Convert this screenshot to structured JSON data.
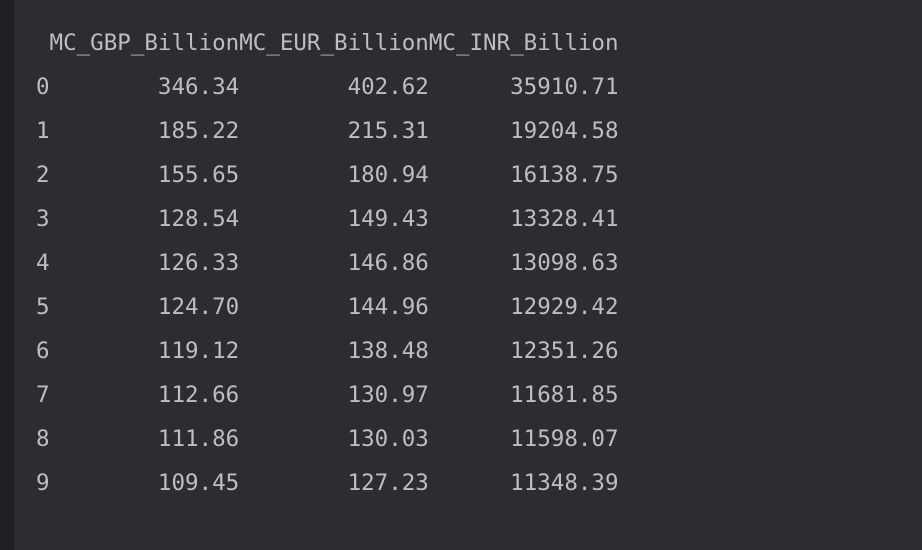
{
  "dataframe": {
    "index_header": "",
    "columns": [
      "MC_GBP_Billion",
      "MC_EUR_Billion",
      "MC_INR_Billion"
    ],
    "rows": [
      {
        "index": "0",
        "gbp": "346.34",
        "eur": "402.62",
        "inr": "35910.71"
      },
      {
        "index": "1",
        "gbp": "185.22",
        "eur": "215.31",
        "inr": "19204.58"
      },
      {
        "index": "2",
        "gbp": "155.65",
        "eur": "180.94",
        "inr": "16138.75"
      },
      {
        "index": "3",
        "gbp": "128.54",
        "eur": "149.43",
        "inr": "13328.41"
      },
      {
        "index": "4",
        "gbp": "126.33",
        "eur": "146.86",
        "inr": "13098.63"
      },
      {
        "index": "5",
        "gbp": "124.70",
        "eur": "144.96",
        "inr": "12929.42"
      },
      {
        "index": "6",
        "gbp": "119.12",
        "eur": "138.48",
        "inr": "12351.26"
      },
      {
        "index": "7",
        "gbp": "112.66",
        "eur": "130.97",
        "inr": "11681.85"
      },
      {
        "index": "8",
        "gbp": "111.86",
        "eur": "130.03",
        "inr": "11598.07"
      },
      {
        "index": "9",
        "gbp": "109.45",
        "eur": "127.23",
        "inr": "11348.39"
      }
    ]
  },
  "colors": {
    "background": "#2b2d30",
    "left_gutter": "#1f2023",
    "text": "#bcbec4"
  }
}
